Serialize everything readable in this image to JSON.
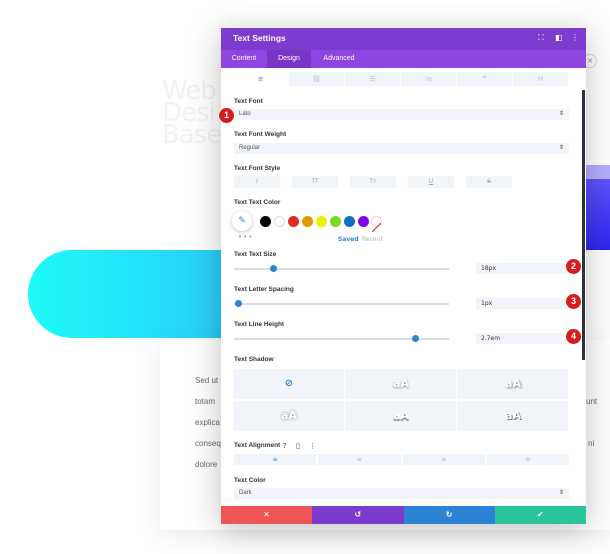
{
  "background": {
    "heading_lines": [
      "Web",
      "Desi",
      "Base"
    ],
    "paragraph_lines": [
      "Sed ut",
      "totam",
      "explica",
      "conseq",
      "dolore"
    ],
    "right_fragments": [
      "unt",
      "ni"
    ]
  },
  "modal": {
    "title": "Text Settings",
    "tabs": [
      {
        "label": "Content"
      },
      {
        "label": "Design"
      },
      {
        "label": "Advanced"
      }
    ],
    "fields": {
      "text_font": {
        "label": "Text Font",
        "value": "Lato"
      },
      "text_font_weight": {
        "label": "Text Font Weight",
        "value": "Regular"
      },
      "text_font_style": {
        "label": "Text Font Style",
        "buttons": [
          "I",
          "TT",
          "Tт",
          "U",
          "S"
        ]
      },
      "text_text_color": {
        "label": "Text Text Color",
        "saved": "Saved",
        "recent": "Recent"
      },
      "text_text_size": {
        "label": "Text Text Size",
        "value": "18px",
        "slider_fraction": 0.18
      },
      "text_letter_spacing": {
        "label": "Text Letter Spacing",
        "value": "1px",
        "slider_fraction": 0.02
      },
      "text_line_height": {
        "label": "Text Line Height",
        "value": "2.7em",
        "slider_fraction": 0.84
      },
      "text_shadow": {
        "label": "Text Shadow",
        "preview_text": "aA"
      },
      "text_alignment": {
        "label": "Text Alignment"
      },
      "text_color": {
        "label": "Text Color",
        "value": "Dark"
      }
    },
    "swatches": [
      "#000000",
      "#ffffff",
      "#e02b20",
      "#e09900",
      "#edf000",
      "#7cda24",
      "#0c71c3",
      "#8300e9"
    ],
    "footer": {
      "colors": [
        "#ef5555",
        "#7c3bcf",
        "#2c83d6",
        "#29c49a"
      ]
    }
  },
  "badges": [
    "1",
    "2",
    "3",
    "4"
  ]
}
